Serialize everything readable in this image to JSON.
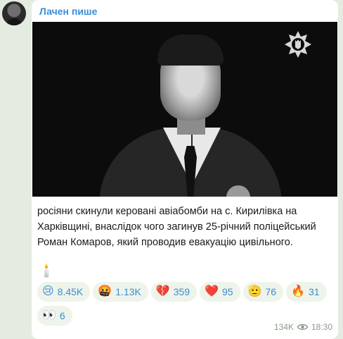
{
  "channel": {
    "name": "Лачен пише"
  },
  "post": {
    "caption": "росіяни скинули керовані авіабомби на с. Кирилівка на\nХарківщині, внаслідок чого загинув 25-річний поліцейський\nРоман Комаров, який проводив евакуацію цивільного.",
    "candle_emoji": "🕯️"
  },
  "reactions": [
    {
      "emoji": "😢",
      "count": "8.45K",
      "icon": "crying-face-icon"
    },
    {
      "emoji": "🤬",
      "count": "1.13K",
      "icon": "cursing-face-icon"
    },
    {
      "emoji": "💔",
      "count": "359",
      "icon": "broken-heart-icon"
    },
    {
      "emoji": "❤️",
      "count": "95",
      "icon": "red-heart-icon"
    },
    {
      "emoji": "🫡",
      "count": "76",
      "icon": "saluting-face-icon"
    },
    {
      "emoji": "🔥",
      "count": "31",
      "icon": "fire-icon"
    },
    {
      "emoji": "👀",
      "count": "6",
      "icon": "eyes-icon"
    }
  ],
  "meta": {
    "views": "134K",
    "time": "18:30"
  },
  "colors": {
    "accent": "#3a8ed6",
    "background": "#e4ebe0",
    "bubble": "#ffffff"
  }
}
